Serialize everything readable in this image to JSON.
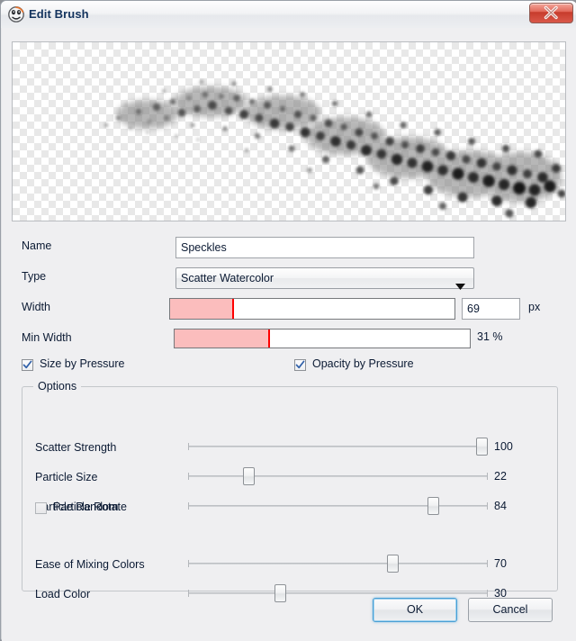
{
  "window": {
    "title": "Edit Brush",
    "icon": "brush-app-icon",
    "close_label": "Close"
  },
  "preview": {
    "name": "brush-stroke-preview",
    "alpha_checker": true
  },
  "fields": {
    "name_label": "Name",
    "name_value": "Speckles",
    "type_label": "Type",
    "type_value": "Scatter Watercolor",
    "width_label": "Width",
    "width_value": "69",
    "width_unit": "px",
    "width_percent": 22,
    "min_width_label": "Min Width",
    "min_width_value": "31 %",
    "min_width_percent": 32
  },
  "pressure": {
    "size_label": "Size by Pressure",
    "size_checked": true,
    "opacity_label": "Opacity by Pressure",
    "opacity_checked": true
  },
  "options": {
    "title": "Options",
    "sliders": [
      {
        "label": "Scatter Strength",
        "value": "100",
        "percent": 100
      },
      {
        "label": "Particle Size",
        "value": "22",
        "percent": 19
      },
      {
        "label": "Particle Random",
        "value": "84",
        "percent": 83
      },
      {
        "label": "Ease of Mixing Colors",
        "value": "70",
        "percent": 69
      },
      {
        "label": "Load Color",
        "value": "30",
        "percent": 30
      }
    ],
    "particle_rotate_label": "Particle Rotate",
    "particle_rotate_checked": false
  },
  "buttons": {
    "ok": "OK",
    "cancel": "Cancel"
  },
  "colors": {
    "gauge_fill": "#fbbdbd",
    "gauge_mark": "#ff0000",
    "title_text": "#12325d",
    "focus_ring": "#4a9fd4"
  }
}
